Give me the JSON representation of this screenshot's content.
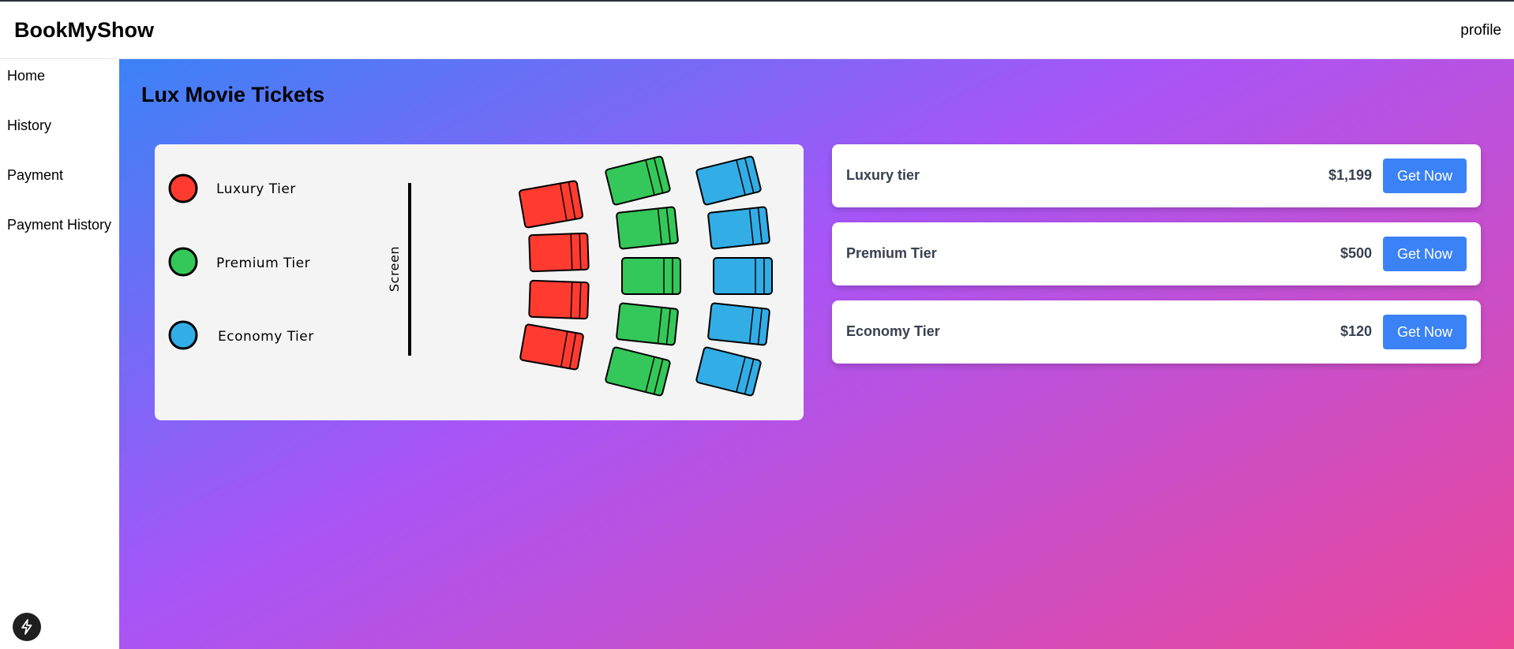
{
  "header": {
    "brand": "BookMyShow",
    "profile_label": "profile"
  },
  "sidebar": {
    "items": [
      {
        "label": "Home"
      },
      {
        "label": "History"
      },
      {
        "label": "Payment"
      },
      {
        "label": "Payment History"
      }
    ]
  },
  "main": {
    "title": "Lux Movie Tickets"
  },
  "seat_map": {
    "screen_label": "Screen",
    "legend": [
      {
        "label": "Luxury Tier",
        "color": "#ff3b30"
      },
      {
        "label": "Premium Tier",
        "color": "#34c759"
      },
      {
        "label": "Economy Tier",
        "color": "#32ade6"
      }
    ]
  },
  "tiers": [
    {
      "name": "Luxury tier",
      "price": "$1,199",
      "button_label": "Get Now"
    },
    {
      "name": "Premium Tier",
      "price": "$500",
      "button_label": "Get Now"
    },
    {
      "name": "Economy Tier",
      "price": "$120",
      "button_label": "Get Now"
    }
  ],
  "colors": {
    "accent": "#3b82f6",
    "gradient_start": "#3b82f6",
    "gradient_mid": "#a855f7",
    "gradient_end": "#ec4899",
    "text_muted": "#374151"
  },
  "floating_button": {
    "icon": "lightning-bolt-icon"
  }
}
